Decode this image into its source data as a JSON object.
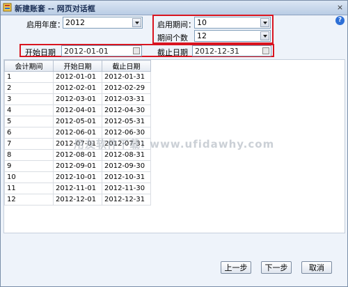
{
  "window": {
    "title": "新建账套 -- 网页对话框",
    "close_glyph": "×"
  },
  "help_glyph": "?",
  "form": {
    "start_year_label": "启用年度：",
    "start_year_value": "2012",
    "start_period_label": "启用期间：",
    "start_period_value": "10",
    "period_count_label": "期间个数",
    "period_count_value": "12",
    "start_date_label": "开始日期",
    "start_date_value": "2012-01-01",
    "end_date_label": "截止日期",
    "end_date_value": "2012-12-31"
  },
  "table": {
    "headers": [
      "会计期间",
      "开始日期",
      "截止日期"
    ],
    "rows": [
      [
        "1",
        "2012-01-01",
        "2012-01-31"
      ],
      [
        "2",
        "2012-02-01",
        "2012-02-29"
      ],
      [
        "3",
        "2012-03-01",
        "2012-03-31"
      ],
      [
        "4",
        "2012-04-01",
        "2012-04-30"
      ],
      [
        "5",
        "2012-05-01",
        "2012-05-31"
      ],
      [
        "6",
        "2012-06-01",
        "2012-06-30"
      ],
      [
        "7",
        "2012-07-01",
        "2012-07-31"
      ],
      [
        "8",
        "2012-08-01",
        "2012-08-31"
      ],
      [
        "9",
        "2012-09-01",
        "2012-09-30"
      ],
      [
        "10",
        "2012-10-01",
        "2012-10-31"
      ],
      [
        "11",
        "2012-11-01",
        "2012-11-30"
      ],
      [
        "12",
        "2012-12-01",
        "2012-12-31"
      ]
    ]
  },
  "buttons": {
    "prev": "上一步",
    "next": "下一步",
    "cancel": "取消"
  },
  "watermark": "用友软件下载: www.ufidawhy.com",
  "colors": {
    "highlight": "#d9141f",
    "window_bg": "#eef3fa"
  }
}
